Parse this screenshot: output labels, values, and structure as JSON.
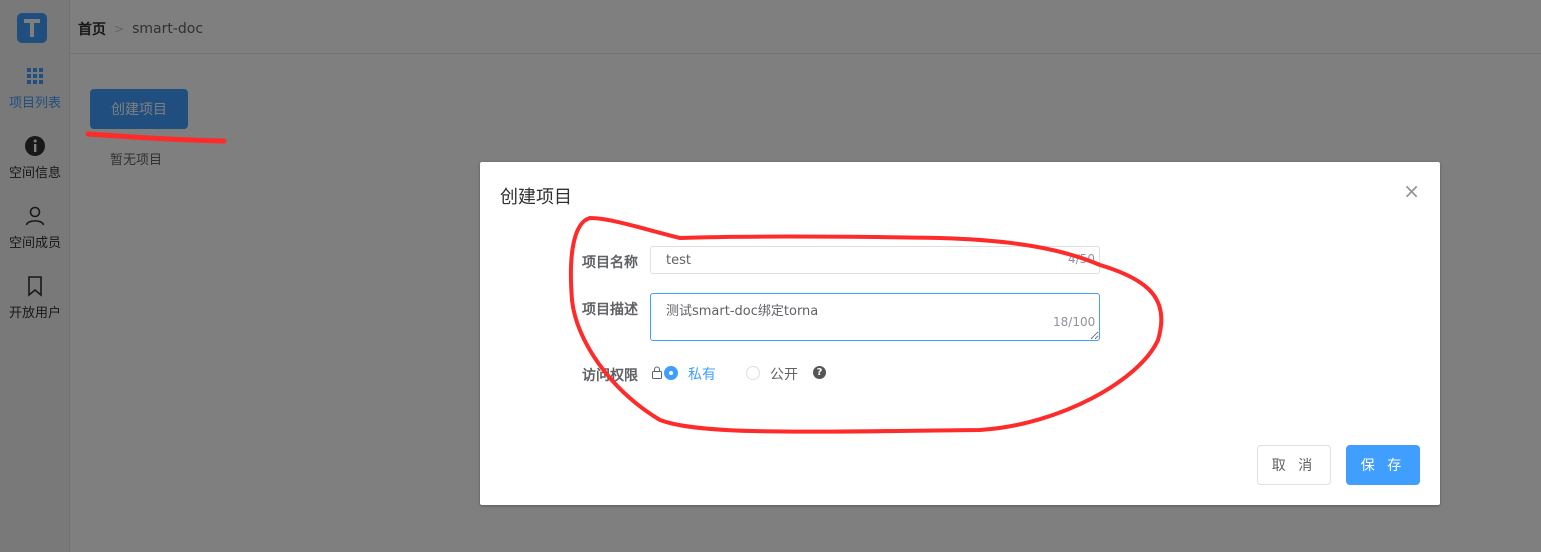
{
  "sidebar": {
    "items": [
      {
        "label": "项目列表",
        "icon": "grid-icon",
        "active": true
      },
      {
        "label": "空间信息",
        "icon": "info-icon"
      },
      {
        "label": "空间成员",
        "icon": "user-icon"
      },
      {
        "label": "开放用户",
        "icon": "bookmark-icon"
      }
    ]
  },
  "breadcrumb": {
    "home": "首页",
    "current": "smart-doc"
  },
  "main": {
    "create_button": "创建项目",
    "empty_text": "暂无项目"
  },
  "dialog": {
    "title": "创建项目",
    "close_glyph": "×",
    "name_label": "项目名称",
    "name_value": "test",
    "name_count": "4/50",
    "desc_label": "项目描述",
    "desc_value": "测试smart-doc绑定torna",
    "desc_count": "18/100",
    "perm_label": "访问权限",
    "perm_private": "私有",
    "perm_public": "公开",
    "perm_selected": "私有",
    "help_glyph": "?",
    "cancel_label": "取 消",
    "save_label": "保 存"
  },
  "colors": {
    "primary": "#409eff",
    "annotation": "#ff2a2a"
  }
}
